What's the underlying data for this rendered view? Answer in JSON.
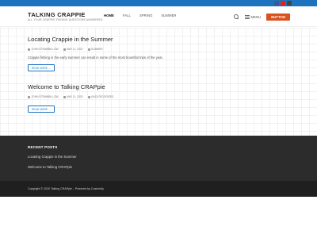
{
  "header": {
    "site_title": "TALKING CRAPPIE",
    "tagline": "ALL YOUR CRAPPIE FISHING QUESTIONS ANSWERED",
    "nav": [
      "HOME",
      "FALL",
      "SPRING",
      "SUMMER"
    ],
    "menu_label": "MENU",
    "button_label": "BUTTON"
  },
  "social": {
    "icons": [
      "facebook-icon",
      "youtube-icon",
      "instagram-icon"
    ]
  },
  "posts": [
    {
      "title": "Locating Crappie in the Summer",
      "author": "JOHN STRAWBILLOW",
      "date": "MAY 11, 2020",
      "category": "SUMMER",
      "excerpt": "Crappie fishing in the early summer can result in some of the most bountiful trips of the year.",
      "read_more": "READ MORE →"
    },
    {
      "title": "Welcome to Talking CRAPpie",
      "author": "JOHN STRAWBILLOW",
      "date": "MAY 11, 2020",
      "category": "UNCATEGORIZED",
      "read_more": "READ MORE →"
    }
  ],
  "footer": {
    "widget_title": "RECENT POSTS",
    "links": [
      "Locating Crappie in the Summer",
      "Welcome to Talking CRAPpie"
    ],
    "copyright": "Copyright © 2020 Talking CRAPpie – Powered by Customify."
  },
  "colors": {
    "accent": "#1e73be",
    "button": "#d9531e",
    "footer": "#2c2c2c",
    "footer_bottom": "#1f1f1f"
  }
}
